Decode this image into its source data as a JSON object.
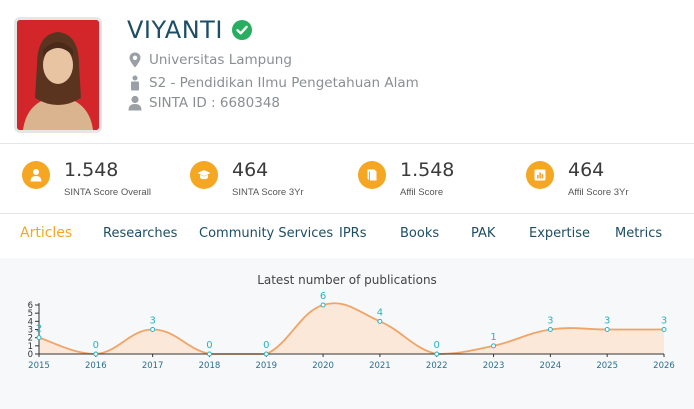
{
  "profile": {
    "name": "VIYANTI",
    "affiliation": "Universitas Lampung",
    "program": "S2 - Pendidikan Ilmu Pengetahuan Alam",
    "sinta_id": "SINTA ID : 6680348"
  },
  "stats": [
    {
      "value": "1.548",
      "label": "SINTA Score Overall",
      "icon": "user-icon"
    },
    {
      "value": "464",
      "label": "SINTA Score 3Yr",
      "icon": "graduation-cap-icon"
    },
    {
      "value": "1.548",
      "label": "Affil Score",
      "icon": "book-icon"
    },
    {
      "value": "464",
      "label": "Affil Score 3Yr",
      "icon": "bar-chart-icon"
    }
  ],
  "tabs": [
    {
      "label": "Articles",
      "active": true
    },
    {
      "label": "Researches"
    },
    {
      "label": "Community Services"
    },
    {
      "label": "IPRs"
    },
    {
      "label": "Books"
    },
    {
      "label": "PAK"
    },
    {
      "label": "Expertise"
    },
    {
      "label": "Metrics"
    }
  ],
  "colors": {
    "accent": "#f5a623",
    "title": "#1d4e66",
    "verified": "#27ae60",
    "line": "#f0a468",
    "area": "#fbe3d1",
    "data_label": "#2bb3c0"
  },
  "chart_data": {
    "type": "area",
    "title": "Latest number of publications",
    "x": [
      "2015",
      "2016",
      "2017",
      "2018",
      "2019",
      "2020",
      "2021",
      "2022",
      "2023",
      "2024",
      "2025",
      "2026"
    ],
    "values": [
      2,
      0,
      3,
      0,
      0,
      6,
      4,
      0,
      1,
      3,
      3,
      3
    ],
    "yticks": [
      "0",
      "1",
      "2",
      "3",
      "4",
      "5",
      "6"
    ],
    "ylim": [
      0,
      6
    ],
    "grid": false
  }
}
